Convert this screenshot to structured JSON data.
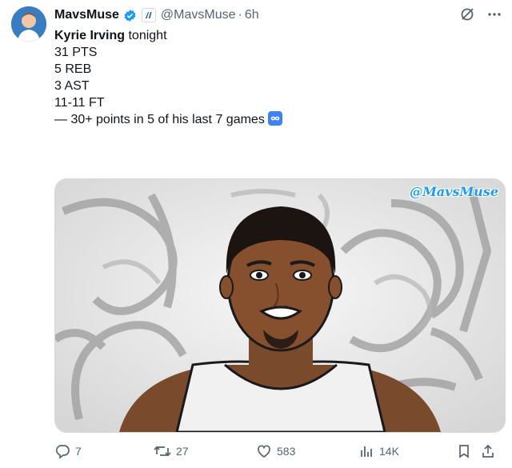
{
  "post": {
    "author_name": "MavsMuse",
    "handle": "@MavsMuse",
    "separator": "·",
    "time": "6h",
    "text_lines": [
      {
        "bold": "Kyrie Irving",
        "rest": " tonight"
      },
      {
        "text": ""
      },
      {
        "text": "31 PTS"
      },
      {
        "text": "5 REB"
      },
      {
        "text": "3 AST"
      },
      {
        "text": "11-11 FT"
      },
      {
        "text": ""
      },
      {
        "text": "— 30+ points in 5 of his last 7 games"
      }
    ],
    "infinity_icon": "infinity-emoji"
  },
  "media": {
    "watermark": "@MavsMuse"
  },
  "actions": {
    "replies": "7",
    "reposts": "27",
    "likes": "583",
    "views": "14K"
  },
  "colors": {
    "accent": "#1d9bf0",
    "muted": "#536471",
    "text": "#0f1419"
  }
}
